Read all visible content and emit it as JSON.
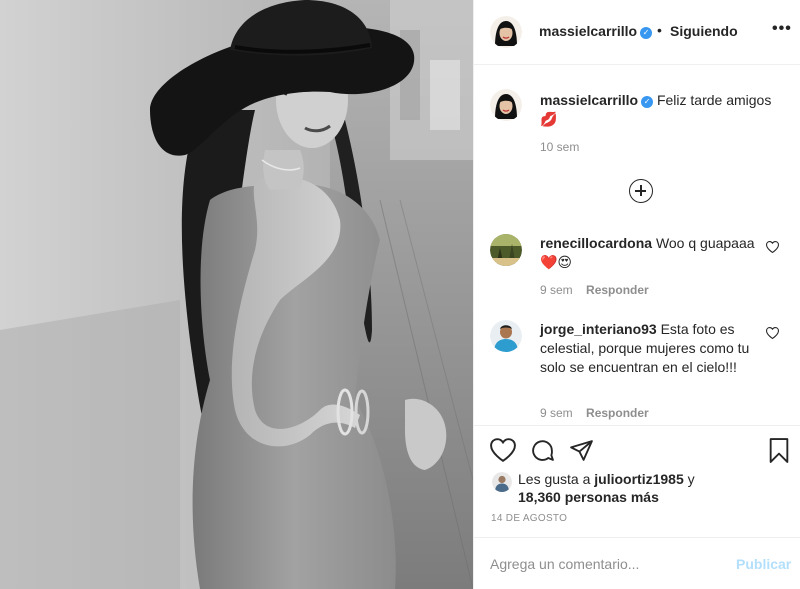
{
  "post": {
    "author": "massielcarrillo",
    "follow_separator": "•",
    "follow_status": "Siguiendo",
    "more_icon": "•••",
    "verified_icon": "✓",
    "caption_text": "Feliz tarde amigos",
    "caption_emoji": "💋",
    "caption_time": "10 sem",
    "load_more_icon": "plus-circle-icon"
  },
  "comments": [
    {
      "username": "renecillocardona",
      "text": "Woo q guapaaa ❤️😍",
      "time": "9 sem",
      "reply": "Responder"
    },
    {
      "username": "jorge_interiano93",
      "text": "Esta foto es celestial, porque mujeres como tu solo se encuentran en el cielo!!!",
      "time": "9 sem",
      "reply": "Responder"
    }
  ],
  "likes": {
    "prefix": "Les gusta a",
    "user": "julioortiz1985",
    "conjunction": "y",
    "others": "18,360 personas más"
  },
  "date": "14 DE AGOSTO",
  "comment_box": {
    "placeholder": "Agrega un comentario...",
    "post_label": "Publicar"
  },
  "colors": {
    "accent": "#3897f0",
    "post_disabled": "#b2dffc",
    "muted": "#8e8e8e",
    "text": "#262626"
  }
}
